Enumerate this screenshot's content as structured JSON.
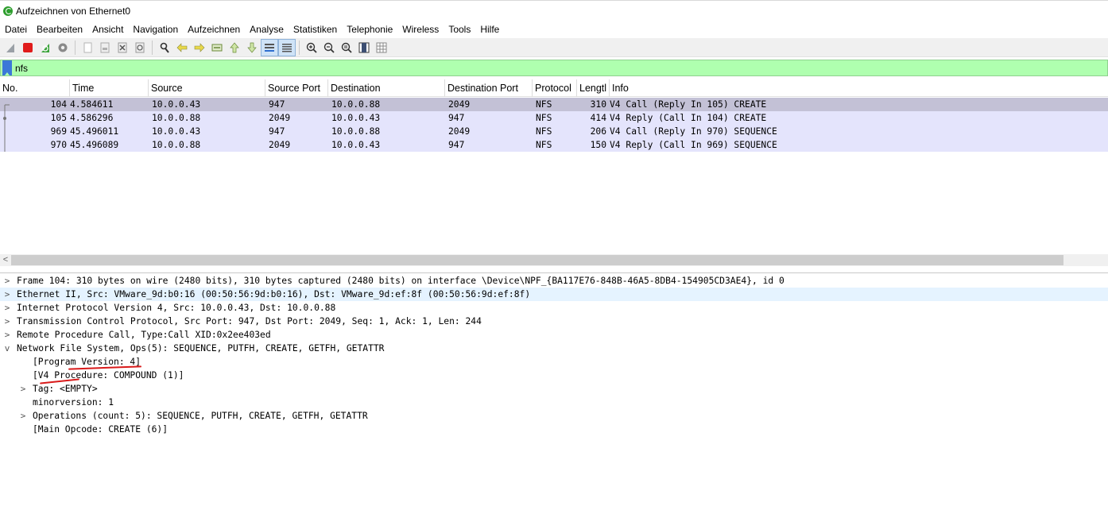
{
  "window": {
    "title": "Aufzeichnen von Ethernet0"
  },
  "menu": [
    "Datei",
    "Bearbeiten",
    "Ansicht",
    "Navigation",
    "Aufzeichnen",
    "Analyse",
    "Statistiken",
    "Telephonie",
    "Wireless",
    "Tools",
    "Hilfe"
  ],
  "filter": {
    "value": "nfs"
  },
  "columns": [
    "No.",
    "Time",
    "Source",
    "Source Port",
    "Destination",
    "Destination Port",
    "Protocol",
    "Lengtl",
    "Info"
  ],
  "packets": [
    {
      "no": "104",
      "time": "4.584611",
      "source": "10.0.0.43",
      "src_port": "947",
      "destination": "10.0.0.88",
      "dst_port": "2049",
      "protocol": "NFS",
      "length": "310",
      "info": "V4 Call (Reply In 105) CREATE"
    },
    {
      "no": "105",
      "time": "4.586296",
      "source": "10.0.0.88",
      "src_port": "2049",
      "destination": "10.0.0.43",
      "dst_port": "947",
      "protocol": "NFS",
      "length": "414",
      "info": "V4 Reply (Call In 104) CREATE"
    },
    {
      "no": "969",
      "time": "45.496011",
      "source": "10.0.0.43",
      "src_port": "947",
      "destination": "10.0.0.88",
      "dst_port": "2049",
      "protocol": "NFS",
      "length": "206",
      "info": "V4 Call (Reply In 970) SEQUENCE"
    },
    {
      "no": "970",
      "time": "45.496089",
      "source": "10.0.0.88",
      "src_port": "2049",
      "destination": "10.0.0.43",
      "dst_port": "947",
      "protocol": "NFS",
      "length": "150",
      "info": "V4 Reply (Call In 969) SEQUENCE"
    }
  ],
  "details": [
    {
      "text": "Frame 104: 310 bytes on wire (2480 bits), 310 bytes captured (2480 bits) on interface \\Device\\NPF_{BA117E76-848B-46A5-8DB4-154905CD3AE4}, id 0",
      "arrow": ">"
    },
    {
      "text": "Ethernet II, Src: VMware_9d:b0:16 (00:50:56:9d:b0:16), Dst: VMware_9d:ef:8f (00:50:56:9d:ef:8f)",
      "arrow": ">"
    },
    {
      "text": "Internet Protocol Version 4, Src: 10.0.0.43, Dst: 10.0.0.88",
      "arrow": ">"
    },
    {
      "text": "Transmission Control Protocol, Src Port: 947, Dst Port: 2049, Seq: 1, Ack: 1, Len: 244",
      "arrow": ">"
    },
    {
      "text": "Remote Procedure Call, Type:Call XID:0x2ee403ed",
      "arrow": ">"
    },
    {
      "text": "Network File System, Ops(5): SEQUENCE, PUTFH, CREATE, GETFH, GETATTR",
      "arrow": "v"
    },
    {
      "text": "[Program Version: 4]",
      "arrow": ""
    },
    {
      "text": "[V4 Procedure: COMPOUND (1)]",
      "arrow": ""
    },
    {
      "text": "Tag: <EMPTY>",
      "arrow": ">"
    },
    {
      "text": "minorversion: 1",
      "arrow": ""
    },
    {
      "text": "Operations (count: 5): SEQUENCE, PUTFH, CREATE, GETFH, GETATTR",
      "arrow": ">"
    },
    {
      "text": "[Main Opcode: CREATE (6)]",
      "arrow": ""
    }
  ],
  "colors": {
    "filter_bg": "#afffaf",
    "row_bg": "#e4e4fc",
    "row_selected": "#c3c1d6",
    "annotation": "#d91a1a"
  },
  "icons": {
    "toolbar": [
      "shark-fin-icon",
      "stop-icon",
      "restart-icon",
      "options-gear-icon",
      "open-file-icon",
      "save-file-icon",
      "close-file-icon",
      "reload-icon",
      "find-icon",
      "back-arrow-icon",
      "forward-arrow-icon",
      "go-to-packet-icon",
      "first-packet-icon",
      "last-packet-icon",
      "autoscroll-icon",
      "colorize-icon",
      "zoom-in-icon",
      "zoom-out-icon",
      "zoom-normal-icon",
      "resize-columns-icon",
      "grid-icon"
    ]
  }
}
